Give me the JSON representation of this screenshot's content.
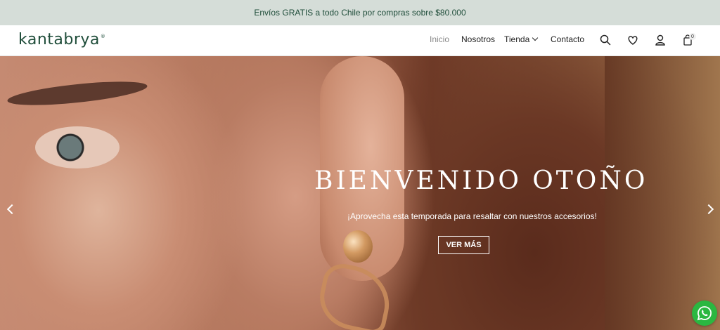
{
  "announcement": {
    "text": "Envíos GRATIS a todo Chile por compras sobre $80.000"
  },
  "header": {
    "logo": "kantabrya",
    "logo_mark": "®",
    "nav": [
      {
        "label": "Inicio",
        "active": true
      },
      {
        "label": "Nosotros",
        "active": false
      },
      {
        "label": "Tienda",
        "active": false,
        "has_dropdown": true
      },
      {
        "label": "Contacto",
        "active": false
      }
    ],
    "icons": [
      "search-icon",
      "heart-icon",
      "user-icon",
      "bag-icon"
    ],
    "cart_count": "0"
  },
  "hero": {
    "title": "BIENVENIDO OTOÑO",
    "subtitle": "¡Aprovecha esta temporada para resaltar con nuestros accesorios!",
    "button_label": "VER MÁS"
  },
  "colors": {
    "brand": "#1f4d3a",
    "announcement_bg": "#d5ddd8",
    "whatsapp": "#2bb741"
  }
}
